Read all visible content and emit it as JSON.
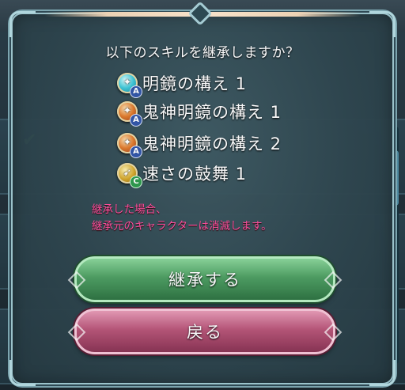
{
  "dialog": {
    "prompt": "以下のスキルを継承しますか？",
    "skills": [
      {
        "name": "明鏡の構え 1",
        "icon": "crystal-stance-icon",
        "slot": "A",
        "color": "#3fc7d8"
      },
      {
        "name": "鬼神明鏡の構え 1",
        "icon": "fire-crystal-stance-icon",
        "slot": "A",
        "color": "#e07b2d"
      },
      {
        "name": "鬼神明鏡の構え 2",
        "icon": "fire-crystal-stance-icon",
        "slot": "A",
        "color": "#e07b2d"
      },
      {
        "name": "速さの鼓舞 1",
        "icon": "speed-rally-icon",
        "slot": "C",
        "color": "#d4a62a"
      }
    ],
    "warning_line1": "継承した場合、",
    "warning_line2": "継承元のキャラクターは消滅します。",
    "confirm_label": "継承する",
    "back_label": "戻る"
  },
  "colors": {
    "warning": "#ff4f9e",
    "confirm_button": "#4f9f63",
    "back_button": "#b95679",
    "frame": "#9fc7cf"
  }
}
